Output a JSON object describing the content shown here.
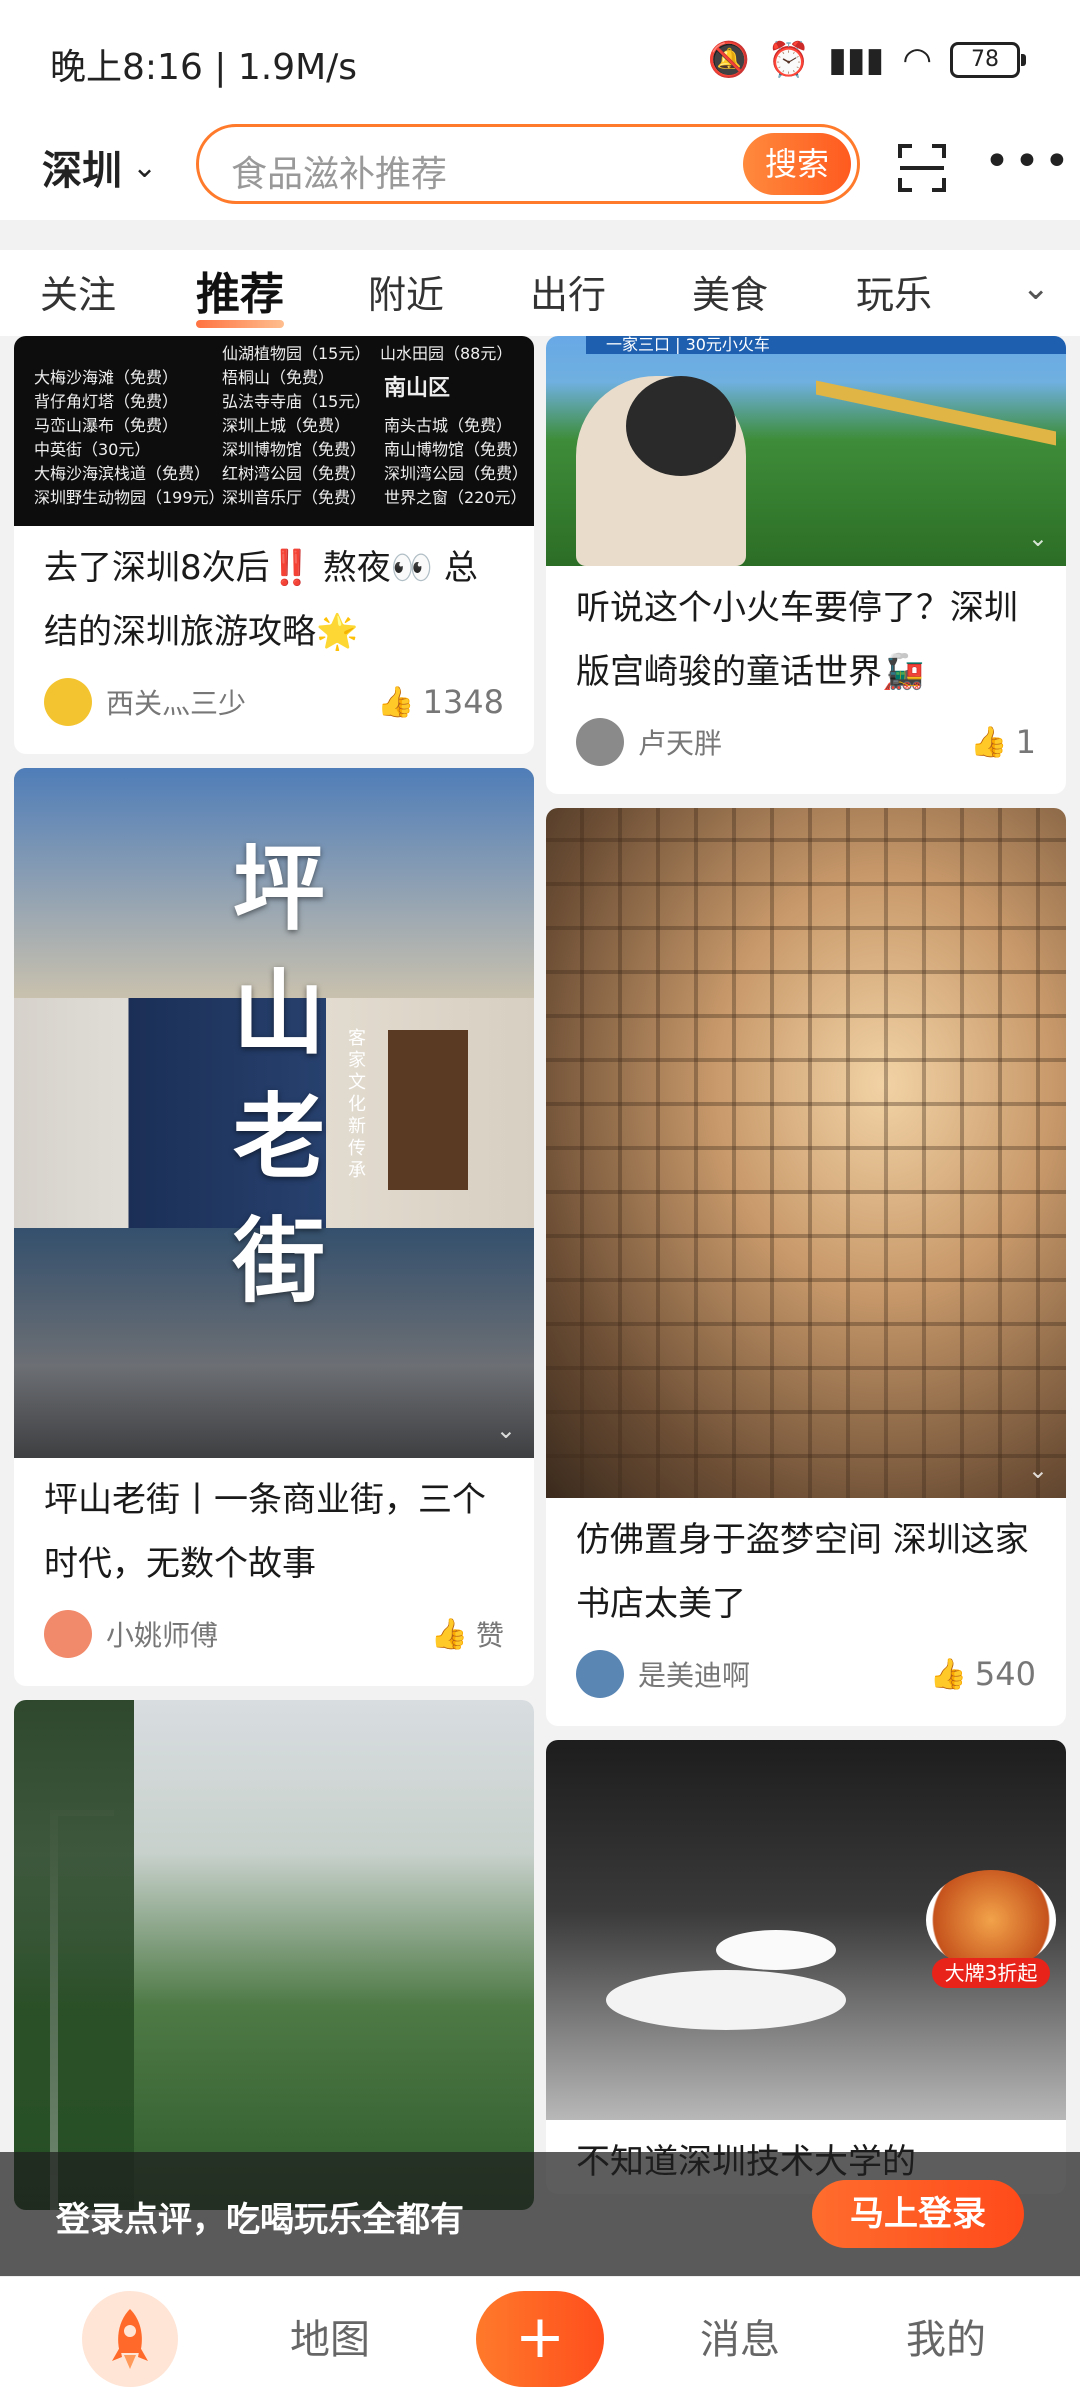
{
  "status": {
    "time": "晚上8:16 | 1.9M/s",
    "battery": "78"
  },
  "header": {
    "city": "深圳",
    "search_placeholder": "食品滋补推荐",
    "search_button": "搜索"
  },
  "tabs": [
    {
      "label": "关注"
    },
    {
      "label": "推荐"
    },
    {
      "label": "附近"
    },
    {
      "label": "出行"
    },
    {
      "label": "美食"
    },
    {
      "label": "玩乐"
    }
  ],
  "cards": {
    "c1": {
      "title": "去了深圳8次后‼️ 熬夜👀 总结的深圳旅游攻略🌟",
      "author": "西关灬三少",
      "likes": "1348",
      "image_text": {
        "region": "南山区",
        "col1": [
          "大梅沙海滩（免费）",
          "背仔角灯塔（免费）",
          "马峦山瀑布（免费）",
          "中英街（30元）",
          "大梅沙海滨栈道（免费）",
          "深圳野生动物园（199元）"
        ],
        "col2": [
          "仙湖植物园（15元）",
          "梧桐山（免费）",
          "弘法寺寺庙（15元）",
          "深圳上城（免费）",
          "深圳博物馆（免费）",
          "红树湾公园（免费）",
          "深圳音乐厅（免费）"
        ],
        "col3": [
          "山水田园（88元）",
          "南头古城（免费）",
          "南山博物馆（免费）",
          "深圳湾公园（免费）",
          "世界之窗（220元）"
        ]
      }
    },
    "c2": {
      "title": "听说这个小火车要停了？深圳版宫崎骏的童话世界🚂",
      "author": "卢天胖",
      "likes": "1",
      "banner": "一家三口 | 30元小火车"
    },
    "c3": {
      "title": "坪山老街丨一条商业街，三个时代，无数个故事",
      "author": "小姚师傅",
      "likes": "赞",
      "overlay": "坪山老街",
      "overlay_sub": "客家文化新传承"
    },
    "c4": {
      "title": "仿佛置身于盗梦空间 深圳这家书店太美了",
      "author": "是美迪啊",
      "likes": "540"
    },
    "c6": {
      "title": "不知道深圳技术大学的",
      "ad_badge": "大牌3折起"
    }
  },
  "login_bar": {
    "text": "登录点评，吃喝玩乐全都有",
    "button": "马上登录"
  },
  "bottom_nav": {
    "map": "地图",
    "messages": "消息",
    "me": "我的"
  }
}
